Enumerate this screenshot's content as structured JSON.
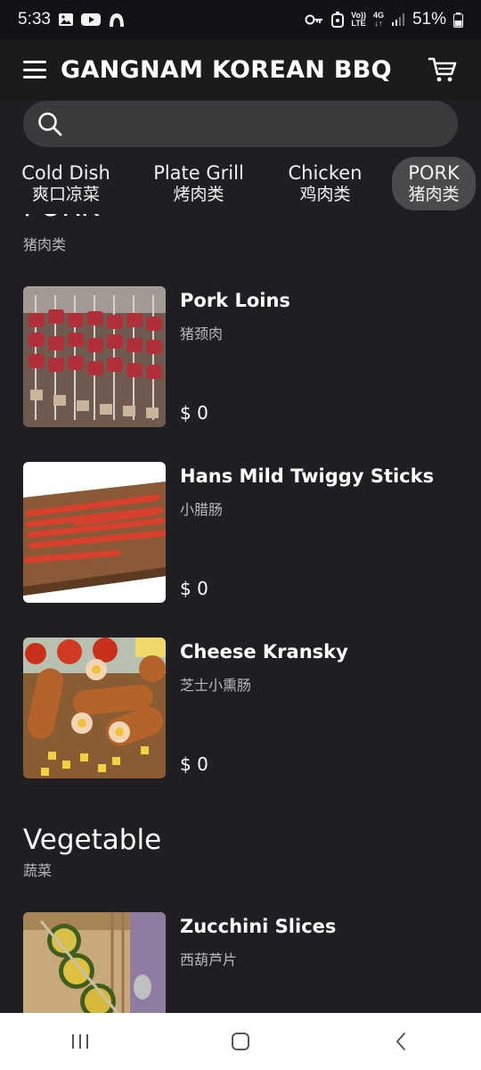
{
  "status_bar": {
    "time": "5:33",
    "network_top": "Vo))",
    "network_bottom": "LTE",
    "net_type": "4G",
    "battery": "51%"
  },
  "header": {
    "title": "GANGNAM KOREAN BBQ",
    "menu_icon": "hamburger-menu-icon",
    "cart_icon": "shopping-cart-icon"
  },
  "search": {
    "placeholder": "",
    "value": ""
  },
  "tabs": [
    {
      "en": "Cold Dish",
      "zh": "爽口凉菜"
    },
    {
      "en": "Plate Grill",
      "zh": "烤肉类"
    },
    {
      "en": "Chicken",
      "zh": "鸡肉类"
    },
    {
      "en": "PORK",
      "zh": "猪肉类",
      "active": true
    }
  ],
  "sections": [
    {
      "title": "PORK",
      "subtitle": "猪肉类",
      "items": [
        {
          "name": "Pork Loins",
          "zh": "猪颈肉",
          "price": "$ 0"
        },
        {
          "name": "Hans Mild Twiggy Sticks",
          "zh": "小腊肠",
          "price": "$ 0"
        },
        {
          "name": "Cheese Kransky",
          "zh": "芝士小熏肠",
          "price": "$ 0"
        }
      ]
    },
    {
      "title": "Vegetable",
      "subtitle": "蔬菜",
      "items": [
        {
          "name": "Zucchini Slices",
          "zh": "西葫芦片"
        }
      ]
    }
  ],
  "nav": {
    "recents": "recents-icon",
    "home": "home-icon",
    "back": "back-icon"
  }
}
